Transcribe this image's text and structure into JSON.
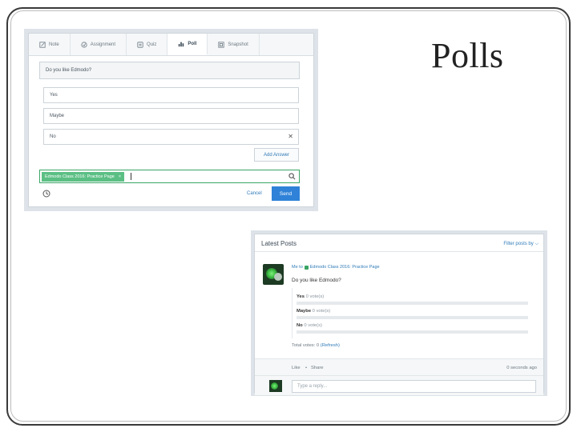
{
  "slide": {
    "title": "Polls"
  },
  "composer": {
    "tabs": [
      {
        "label": "Note",
        "icon": "note-icon"
      },
      {
        "label": "Assignment",
        "icon": "assignment-icon"
      },
      {
        "label": "Quiz",
        "icon": "quiz-icon"
      },
      {
        "label": "Poll",
        "icon": "poll-icon",
        "active": true
      },
      {
        "label": "Snapshot",
        "icon": "snapshot-icon"
      }
    ],
    "question": "Do you like Edmodo?",
    "answers": [
      "Yes",
      "Maybe",
      "No"
    ],
    "add_answer": "Add Answer",
    "recipient_chip": "Edmodo Class 2016: Practice Page",
    "recipient_remove": "×",
    "cancel": "Cancel",
    "send": "Send",
    "accent": "#2f82d8"
  },
  "posts": {
    "title": "Latest Posts",
    "filter": "Filter posts by",
    "meta_prefix": "Me to",
    "meta_group": "Edmodo Class 2016: Practice Page",
    "question": "Do you like Edmodo?",
    "options": [
      {
        "label": "Yes",
        "votes": "0 vote(s)",
        "fraction": 0
      },
      {
        "label": "Maybe",
        "votes": "0 vote(s)",
        "fraction": 0
      },
      {
        "label": "No",
        "votes": "0 vote(s)",
        "fraction": 0
      }
    ],
    "total_label": "Total votes: 0",
    "total_link": "(Refresh)",
    "like": "Like",
    "share": "Share",
    "timestamp": "0 seconds ago",
    "reply_placeholder": "Type a reply..."
  }
}
